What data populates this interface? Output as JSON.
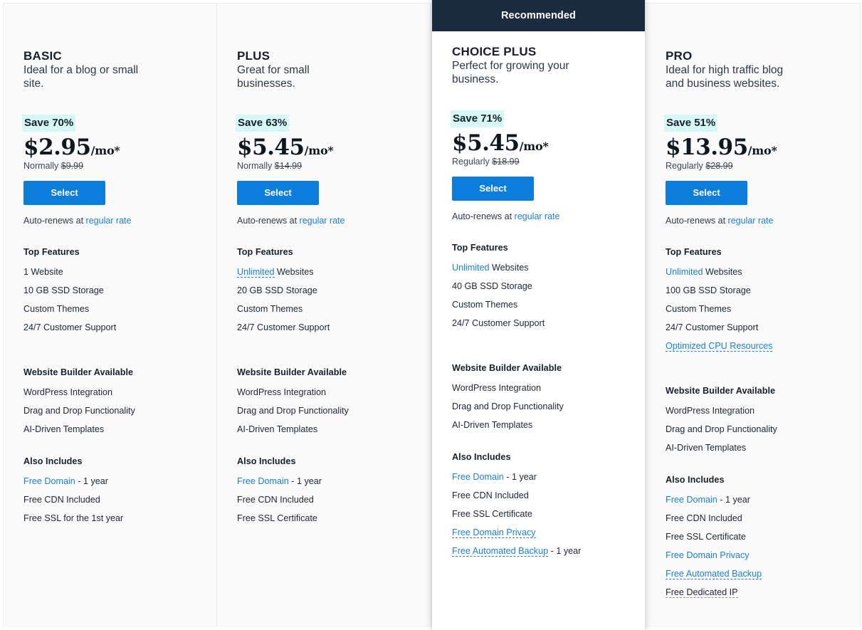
{
  "colors": {
    "accent_blue": "#0d7ddb",
    "link_blue": "#1b7fd4",
    "ribbon_navy": "#1b2c40",
    "save_highlight": "#d7f7f7",
    "card_bg": "#fafafa",
    "featured_bg": "#ffffff"
  },
  "ribbon": {
    "label": "Recommended"
  },
  "common": {
    "select_label": "Select",
    "renew_prefix": "Auto-renews at ",
    "renew_link": "regular rate",
    "top_features_title": "Top Features",
    "builder_title": "Website Builder Available",
    "also_includes_title": "Also Includes"
  },
  "plans": [
    {
      "id": "basic",
      "name": "BASIC",
      "tagline": "Ideal for a blog or small site.",
      "save_badge": "Save 70%",
      "price": "$2.95",
      "period": "/mo*",
      "compare_label": "Normally",
      "compare_price": "$9.99",
      "featured": false,
      "top_features": [
        {
          "text": "1 Website",
          "link": null,
          "tooltip": false
        },
        {
          "text": "10 GB SSD Storage",
          "link": null,
          "tooltip": false
        },
        {
          "text": "Custom Themes",
          "link": null,
          "tooltip": false
        },
        {
          "text": "24/7 Customer Support",
          "link": null,
          "tooltip": false
        }
      ],
      "builder_features": [
        {
          "text": "WordPress Integration",
          "link": null,
          "tooltip": false
        },
        {
          "text": "Drag and Drop Functionality",
          "link": null,
          "tooltip": false
        },
        {
          "text": "AI-Driven Templates",
          "link": null,
          "tooltip": false
        }
      ],
      "also_includes": [
        {
          "link": "Free Domain",
          "text": " - 1 year",
          "tooltip": false
        },
        {
          "link": null,
          "text": "Free CDN Included",
          "tooltip": false
        },
        {
          "link": null,
          "text": "Free SSL for the 1st year",
          "tooltip": false
        }
      ]
    },
    {
      "id": "plus",
      "name": "PLUS",
      "tagline": "Great for small businesses.",
      "save_badge": "Save 63%",
      "price": "$5.45",
      "period": "/mo*",
      "compare_label": "Normally",
      "compare_price": "$14.99",
      "featured": false,
      "top_features": [
        {
          "text": " Websites",
          "link": "Unlimited",
          "tooltip": true
        },
        {
          "text": "20 GB SSD Storage",
          "link": null,
          "tooltip": false
        },
        {
          "text": "Custom Themes",
          "link": null,
          "tooltip": false
        },
        {
          "text": "24/7 Customer Support",
          "link": null,
          "tooltip": false
        }
      ],
      "builder_features": [
        {
          "text": "WordPress Integration",
          "link": null,
          "tooltip": false
        },
        {
          "text": "Drag and Drop Functionality",
          "link": null,
          "tooltip": false
        },
        {
          "text": "AI-Driven Templates",
          "link": null,
          "tooltip": false
        }
      ],
      "also_includes": [
        {
          "link": "Free Domain",
          "text": " - 1 year",
          "tooltip": false
        },
        {
          "link": null,
          "text": "Free CDN Included",
          "tooltip": false
        },
        {
          "link": null,
          "text": "Free SSL Certificate",
          "tooltip": false
        }
      ]
    },
    {
      "id": "choice-plus",
      "name": "CHOICE PLUS",
      "tagline": "Perfect for growing your business.",
      "save_badge": "Save 71%",
      "price": "$5.45",
      "period": "/mo*",
      "compare_label": "Regularly",
      "compare_price": "$18.99",
      "featured": true,
      "top_features": [
        {
          "text": " Websites",
          "link": "Unlimited",
          "tooltip": false
        },
        {
          "text": "40 GB SSD Storage",
          "link": null,
          "tooltip": false
        },
        {
          "text": "Custom Themes",
          "link": null,
          "tooltip": false
        },
        {
          "text": "24/7 Customer Support",
          "link": null,
          "tooltip": false
        }
      ],
      "builder_features": [
        {
          "text": "WordPress Integration",
          "link": null,
          "tooltip": false
        },
        {
          "text": "Drag and Drop Functionality",
          "link": null,
          "tooltip": false
        },
        {
          "text": "AI-Driven Templates",
          "link": null,
          "tooltip": false
        }
      ],
      "also_includes": [
        {
          "link": "Free Domain",
          "text": " - 1 year",
          "tooltip": false
        },
        {
          "link": null,
          "text": "Free CDN Included",
          "tooltip": false
        },
        {
          "link": null,
          "text": "Free SSL Certificate",
          "tooltip": false
        },
        {
          "link": "Free Domain Privacy",
          "text": "",
          "tooltip": true
        },
        {
          "link": "Free Automated Backup",
          "text": " - 1 year",
          "tooltip": true
        }
      ]
    },
    {
      "id": "pro",
      "name": "PRO",
      "tagline": "Ideal for high traffic blog and business websites.",
      "save_badge": "Save 51%",
      "price": "$13.95",
      "period": "/mo*",
      "compare_label": "Regularly",
      "compare_price": "$28.99",
      "featured": false,
      "top_features": [
        {
          "text": " Websites",
          "link": "Unlimited",
          "tooltip": false
        },
        {
          "text": "100 GB SSD Storage",
          "link": null,
          "tooltip": false
        },
        {
          "text": "Custom Themes",
          "link": null,
          "tooltip": false
        },
        {
          "text": "24/7 Customer Support",
          "link": null,
          "tooltip": false
        },
        {
          "text": "",
          "link": "Optimized CPU Resources",
          "tooltip": true
        }
      ],
      "builder_features": [
        {
          "text": "WordPress Integration",
          "link": null,
          "tooltip": false
        },
        {
          "text": "Drag and Drop Functionality",
          "link": null,
          "tooltip": false
        },
        {
          "text": "AI-Driven Templates",
          "link": null,
          "tooltip": false
        }
      ],
      "also_includes": [
        {
          "link": "Free Domain",
          "text": " - 1 year",
          "tooltip": false
        },
        {
          "link": null,
          "text": "Free CDN Included",
          "tooltip": false
        },
        {
          "link": null,
          "text": "Free SSL Certificate",
          "tooltip": false
        },
        {
          "link": "Free Domain Privacy",
          "text": "",
          "tooltip": false
        },
        {
          "link": "Free Automated Backup",
          "text": "",
          "tooltip": true
        },
        {
          "link": null,
          "text": "Free Dedicated IP",
          "tooltip": true
        }
      ]
    }
  ]
}
